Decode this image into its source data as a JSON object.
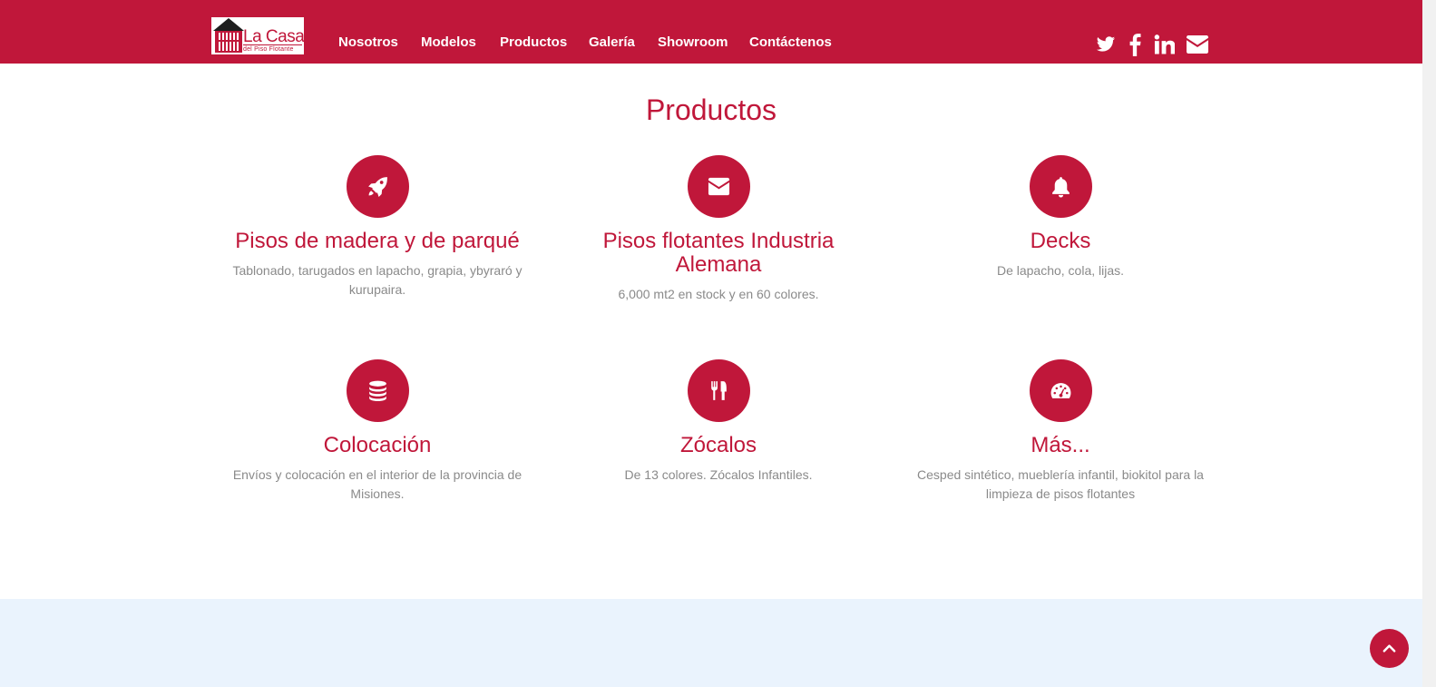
{
  "brand": {
    "logo_main": "La Casa",
    "logo_sub": "del Piso Flotante",
    "color": "#c0173a"
  },
  "nav": {
    "items": [
      {
        "label": "Nosotros"
      },
      {
        "label": "Modelos"
      },
      {
        "label": "Productos"
      },
      {
        "label": "Galería"
      },
      {
        "label": "Showroom"
      },
      {
        "label": "Contáctenos"
      }
    ]
  },
  "social": [
    "twitter-icon",
    "facebook-icon",
    "linkedin-icon",
    "envelope-icon"
  ],
  "section": {
    "title": "Productos",
    "features": [
      {
        "icon": "rocket-icon",
        "title": "Pisos de madera y de parqué",
        "description": "Tablonado, tarugados en lapacho, grapia, ybyraró y kurupaira."
      },
      {
        "icon": "envelope-icon",
        "title": "Pisos flotantes Industria Alemana",
        "description": "6,000 mt2 en stock y en 60 colores."
      },
      {
        "icon": "bell-icon",
        "title": "Decks",
        "description": "De lapacho, cola, lijas."
      },
      {
        "icon": "database-icon",
        "title": "Colocación",
        "description": "Envíos y colocación en el interior de la provincia de Misiones."
      },
      {
        "icon": "cutlery-icon",
        "title": "Zócalos",
        "description": "De 13 colores. Zócalos Infantiles."
      },
      {
        "icon": "dashboard-icon",
        "title": "Más...",
        "description": "Cesped sintético, mueblería infantil, biokitol para la limpieza de pisos flotantes"
      }
    ]
  },
  "scroll_top": {
    "icon": "chevron-up-icon"
  }
}
